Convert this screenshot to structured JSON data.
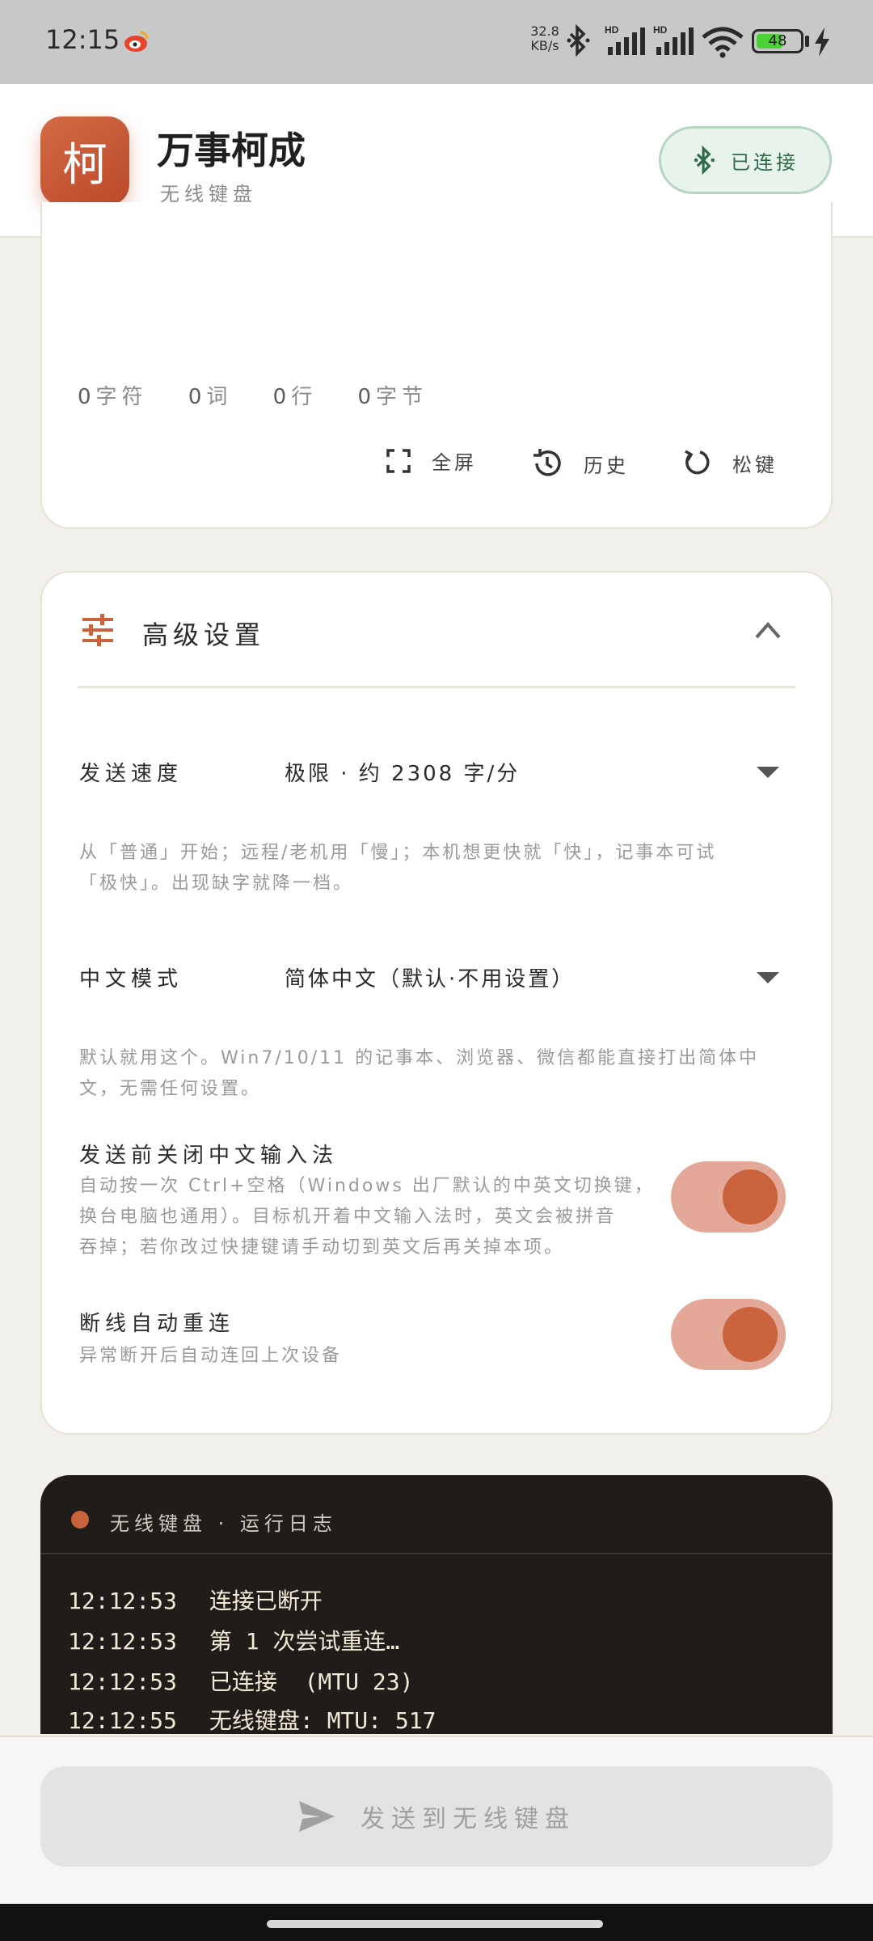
{
  "status_bar": {
    "time": "12:15",
    "net_speed_value": "32.8",
    "net_speed_unit": "KB/s",
    "sig1_label": "HD",
    "sig2_label": "HD",
    "battery": "48",
    "icons": [
      "weibo-icon",
      "bluetooth-icon",
      "signal-icon",
      "wifi-icon",
      "battery-icon",
      "charging-icon"
    ]
  },
  "header": {
    "logo_char": "柯",
    "title": "万事柯成",
    "subtitle": "无线键盘",
    "connection_label": "已连接",
    "colors": {
      "brand": "#c9633e",
      "connected": "#2f6b46"
    }
  },
  "editor": {
    "stats": [
      {
        "num": "0",
        "unit": "字符"
      },
      {
        "num": "0",
        "unit": "词"
      },
      {
        "num": "0",
        "unit": "行"
      },
      {
        "num": "0",
        "unit": "字节"
      }
    ],
    "tools": {
      "fullscreen": "全屏",
      "history": "历史",
      "release": "松键"
    }
  },
  "advanced": {
    "title": "高级设置",
    "speed_label": "发送速度",
    "speed_value": "极限 · 约 2308 字/分",
    "speed_hint_1": "从「普通」开始；远程/老机用「慢」；本机想更快就「快」，记事本可试",
    "speed_hint_2": "「极快」。出现缺字就降一档。",
    "cn_label": "中文模式",
    "cn_value": "简体中文（默认·不用设置）",
    "cn_hint_1": "默认就用这个。Win7/10/11 的记事本、浏览器、微信都能直接打出简体中",
    "cn_hint_2": "文，无需任何设置。",
    "ime_title": "发送前关闭中文输入法",
    "ime_desc_1": "自动按一次 Ctrl+空格（Windows 出厂默认的中英文切换键，",
    "ime_desc_2": "换台电脑也通用）。目标机开着中文输入法时，英文会被拼音",
    "ime_desc_3": "吞掉；若你改过快捷键请手动切到英文后再关掉本项。",
    "ime_on": true,
    "reconnect_title": "断线自动重连",
    "reconnect_desc": "异常断开后自动连回上次设备",
    "reconnect_on": true
  },
  "log": {
    "title": "无线键盘 · 运行日志",
    "entries": [
      {
        "time": "12:12:53",
        "msg": "连接已断开"
      },
      {
        "time": "12:12:53",
        "msg": "第 1 次尝试重连…"
      },
      {
        "time": "12:12:53",
        "msg": "已连接  (MTU 23)"
      },
      {
        "time": "12:12:55",
        "msg": "无线键盘: MTU: 517"
      }
    ]
  },
  "send_button": {
    "label": "发送到无线键盘"
  }
}
